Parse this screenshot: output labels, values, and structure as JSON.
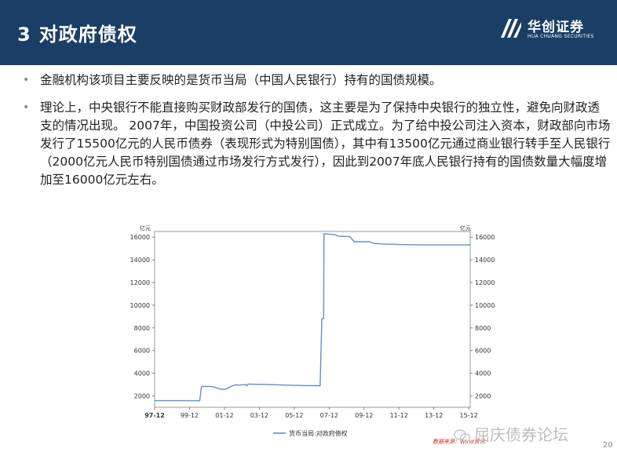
{
  "header": {
    "section_number": "3",
    "title": "对政府债权",
    "logo_cn": "华创证券",
    "logo_en": "HUA CHUANG SECURITIES"
  },
  "bullets": [
    "金融机构该项目主要反映的是货币当局（中国人民银行）持有的国债规模。",
    "理论上，中央银行不能直接购买财政部发行的国债，这主要是为了保持中央银行的独立性，避免向财政透支的情况出现。 2007年，中国投资公司（中投公司）正式成立。为了给中投公司注入资本，财政部向市场发行了15500亿元的人民币债券（表现形式为特别国债），其中有13500亿元通过商业银行转手至人民银行（2000亿元人民币特别国债通过市场发行方式发行），因此到2007年底人民银行持有的国债数量大幅度增加至16000亿元左右。"
  ],
  "chart_data": {
    "type": "line",
    "ylabel_left": "亿元",
    "ylabel_right": "亿元",
    "ylim": [
      1000,
      16500
    ],
    "yticks": [
      2000,
      4000,
      6000,
      8000,
      10000,
      12000,
      14000,
      16000
    ],
    "xlim": [
      1997.917,
      2016.0
    ],
    "xticks": [
      {
        "label": "97-12",
        "x": 1997.917
      },
      {
        "label": "99-12",
        "x": 1999.917
      },
      {
        "label": "01-12",
        "x": 2001.917
      },
      {
        "label": "03-12",
        "x": 2003.917
      },
      {
        "label": "05-12",
        "x": 2005.917
      },
      {
        "label": "07-12",
        "x": 2007.917
      },
      {
        "label": "09-12",
        "x": 2009.917
      },
      {
        "label": "11-12",
        "x": 2011.917
      },
      {
        "label": "13-12",
        "x": 2013.917
      },
      {
        "label": "15-12",
        "x": 2015.917
      }
    ],
    "grid": false,
    "legend_position": "bottom",
    "series": [
      {
        "name": "货币当局:对政府债权",
        "color": "#5b8fd6",
        "x": [
          1997.92,
          2000.5,
          2000.6,
          2000.65,
          2001.2,
          2001.5,
          2001.7,
          2002.0,
          2002.3,
          2002.4,
          2002.6,
          2002.65,
          2003.1,
          2003.2,
          2003.25,
          2004.5,
          2005.5,
          2006.5,
          2007.3,
          2007.4,
          2007.5,
          2007.6,
          2007.62,
          2007.7,
          2008.3,
          2008.4,
          2009.1,
          2009.3,
          2009.35,
          2010.2,
          2010.4,
          2010.45,
          2011.0,
          2011.5,
          2012.0,
          2013.0,
          2014.0,
          2015.0,
          2016.0
        ],
        "y": [
          1580,
          1580,
          2800,
          2850,
          2830,
          2700,
          2600,
          2600,
          2850,
          2900,
          3000,
          2950,
          3000,
          2900,
          3050,
          3000,
          2950,
          2920,
          2900,
          2900,
          8800,
          8850,
          16300,
          16300,
          16200,
          16100,
          16050,
          15700,
          15600,
          15600,
          15500,
          15450,
          15400,
          15380,
          15350,
          15320,
          15320,
          15320,
          15320
        ]
      }
    ]
  },
  "footer": {
    "source_note": "数据来源：Wind资讯",
    "watermark": "屈庆债券论坛",
    "page_number": "20"
  }
}
